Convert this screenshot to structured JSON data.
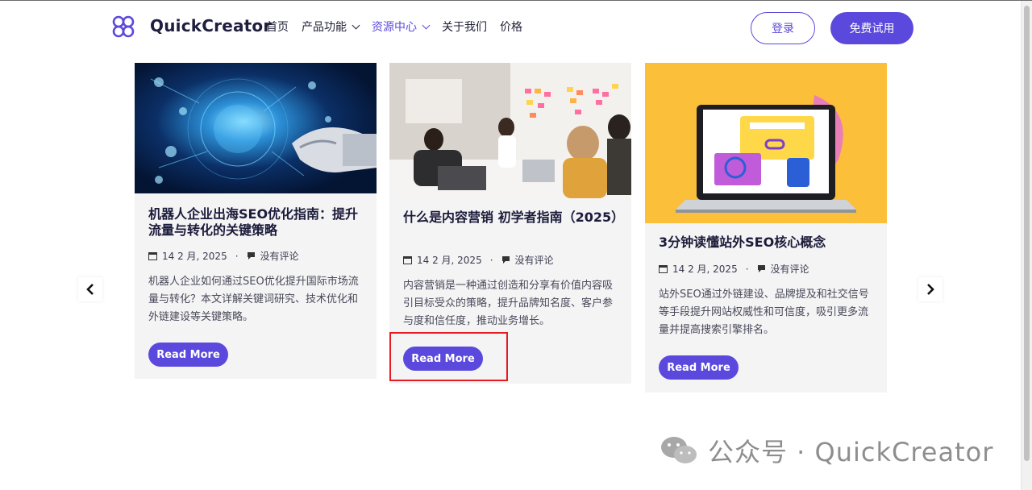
{
  "header": {
    "brand": "QuickCreator",
    "nav": [
      {
        "label": "首页",
        "dropdown": false,
        "active": false
      },
      {
        "label": "产品功能",
        "dropdown": true,
        "active": false
      },
      {
        "label": "资源中心",
        "dropdown": true,
        "active": true
      },
      {
        "label": "关于我们",
        "dropdown": false,
        "active": false
      },
      {
        "label": "价格",
        "dropdown": false,
        "active": false
      }
    ],
    "login_label": "登录",
    "trial_label": "免费试用"
  },
  "cards": [
    {
      "title": "机器人企业出海SEO优化指南：提升流量与转化的关键策略",
      "date": "14 2 月, 2025",
      "comments": "没有评论",
      "excerpt": "机器人企业如何通过SEO优化提升国际市场流量与转化？本文详解关键词研究、技术优化和外链建设等关键策略。",
      "button": "Read More"
    },
    {
      "title": "什么是内容营销 初学者指南（2025）",
      "date": "14 2 月, 2025",
      "comments": "没有评论",
      "excerpt": "内容营销是一种通过创造和分享有价值内容吸引目标受众的策略，提升品牌知名度、客户参与度和信任度，推动业务增长。",
      "button": "Read More"
    },
    {
      "title": "3分钟读懂站外SEO核心概念",
      "date": "14 2 月, 2025",
      "comments": "没有评论",
      "excerpt": "站外SEO通过外链建设、品牌提及和社交信号等手段提升网站权威性和可信度，吸引更多流量并提高搜索引擎排名。",
      "button": "Read More"
    }
  ],
  "watermark": "公众号 · QuickCreator",
  "icons": {
    "calendar": "calendar-icon",
    "comment": "comment-icon",
    "prev": "chevron-left-icon",
    "next": "chevron-right-icon"
  },
  "colors": {
    "accent": "#5b49dd",
    "card_bg": "#f4f4f5",
    "highlight": "#e41b23"
  }
}
